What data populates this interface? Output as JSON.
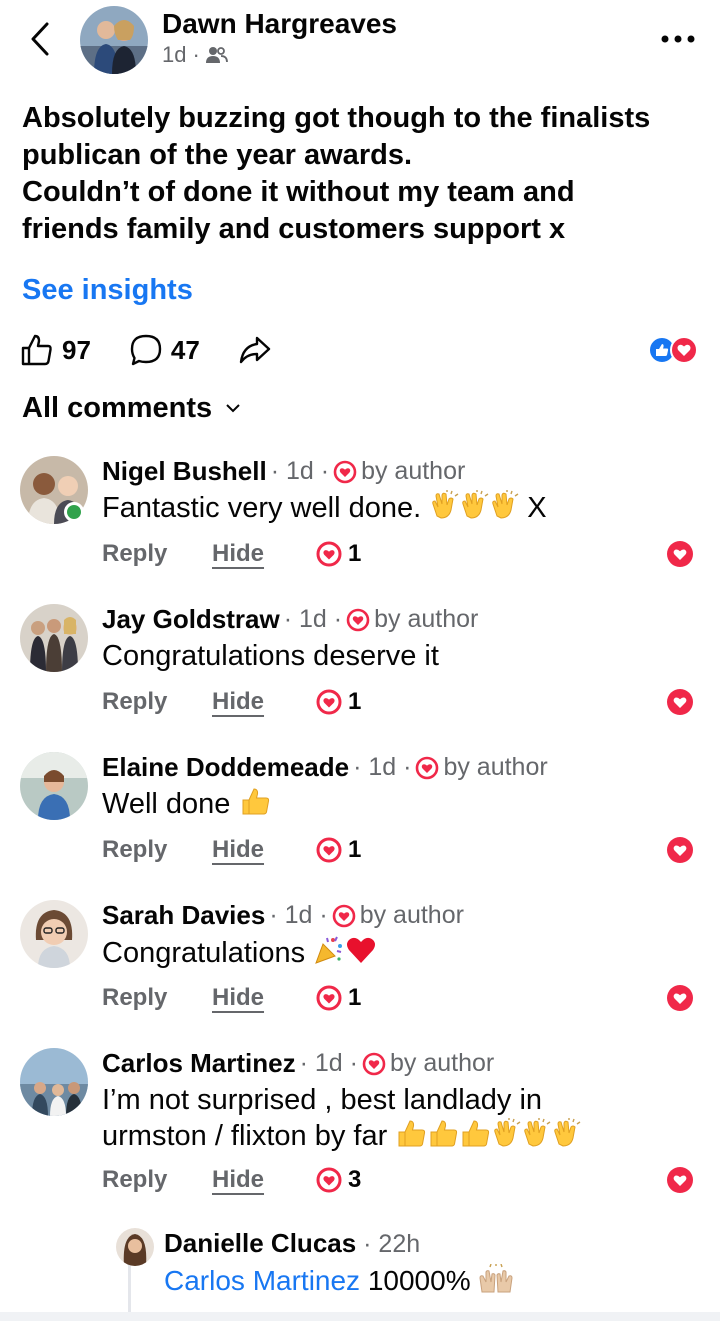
{
  "post": {
    "author": "Dawn Hargreaves",
    "time": "1d",
    "time_sep": "·",
    "audience_icon": "friends-icon",
    "text_lines": [
      "Absolutely buzzing got though to the finalists",
      "publican of the year awards.",
      "Couldn’t of done it without my team and",
      "friends family and customers support x"
    ],
    "insights_label": "See insights",
    "likes": "97",
    "comments": "47",
    "reaction_types": [
      "like",
      "love"
    ]
  },
  "comments_header": "All comments",
  "comments": [
    {
      "name": "Nigel Bushell",
      "meta": "· 1d ·",
      "author_badge": "by author",
      "text": "Fantastic very well done.",
      "emojis": [
        "clap",
        "clap",
        "clap"
      ],
      "text_suffix": "X",
      "reply_label": "Reply",
      "hide_label": "Hide",
      "reaction_count": "1",
      "online": true
    },
    {
      "name": "Jay Goldstraw",
      "meta": "· 1d ·",
      "author_badge": "by author",
      "text": "Congratulations deserve it",
      "emojis": [],
      "text_suffix": "",
      "reply_label": "Reply",
      "hide_label": "Hide",
      "reaction_count": "1",
      "online": false
    },
    {
      "name": "Elaine Doddemeade",
      "meta": "· 1d ·",
      "author_badge": "by author",
      "text": "Well done",
      "emojis": [
        "thumbs-up"
      ],
      "text_suffix": "",
      "reply_label": "Reply",
      "hide_label": "Hide",
      "reaction_count": "1",
      "online": false
    },
    {
      "name": "Sarah Davies",
      "meta": "· 1d ·",
      "author_badge": "by author",
      "text": "Congratulations",
      "emojis": [
        "party-popper",
        "red-heart"
      ],
      "text_suffix": "",
      "reply_label": "Reply",
      "hide_label": "Hide",
      "reaction_count": "1",
      "online": false
    },
    {
      "name": "Carlos Martinez",
      "meta": "· 1d ·",
      "author_badge": "by author",
      "text_line1": "I’m not surprised , best landlady in",
      "text_line2": "urmston / flixton by far",
      "emojis": [
        "thumbs-up",
        "thumbs-up",
        "thumbs-up",
        "clap",
        "clap",
        "clap"
      ],
      "reply_label": "Reply",
      "hide_label": "Hide",
      "reaction_count": "3",
      "online": false
    }
  ],
  "nested_reply": {
    "name": "Danielle Clucas",
    "meta": "· 22h",
    "mention": "Carlos Martinez",
    "text": "10000%",
    "emojis": [
      "raising-hands"
    ]
  },
  "colors": {
    "accent": "#1877f2",
    "love": "#f02849",
    "secondary_text": "#65676b",
    "online": "#31a24c"
  }
}
